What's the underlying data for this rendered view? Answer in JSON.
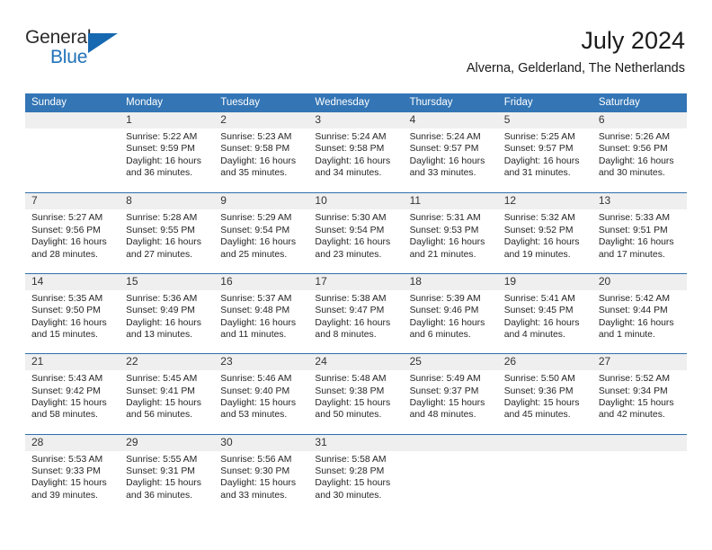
{
  "brand": {
    "word_one": "General",
    "word_two": "Blue",
    "logo_icon": "triangle-logo-icon",
    "colors": {
      "general": "#2b2b2b",
      "blue": "#2272b8",
      "triangle": "#1668b0"
    }
  },
  "header": {
    "title": "July 2024",
    "subtitle": "Alverna, Gelderland, The Netherlands"
  },
  "theme": {
    "header_bar": "#3375b5",
    "row_divider": "#2f6fad",
    "number_band": "#efefef",
    "text": "#262626"
  },
  "calendar": {
    "day_headers": [
      "Sunday",
      "Monday",
      "Tuesday",
      "Wednesday",
      "Thursday",
      "Friday",
      "Saturday"
    ],
    "weeks": [
      [
        {
          "day": "",
          "empty": true,
          "sunrise": "",
          "sunset": "",
          "daylight_1": "",
          "daylight_2": ""
        },
        {
          "day": "1",
          "sunrise": "Sunrise: 5:22 AM",
          "sunset": "Sunset: 9:59 PM",
          "daylight_1": "Daylight: 16 hours",
          "daylight_2": "and 36 minutes."
        },
        {
          "day": "2",
          "sunrise": "Sunrise: 5:23 AM",
          "sunset": "Sunset: 9:58 PM",
          "daylight_1": "Daylight: 16 hours",
          "daylight_2": "and 35 minutes."
        },
        {
          "day": "3",
          "sunrise": "Sunrise: 5:24 AM",
          "sunset": "Sunset: 9:58 PM",
          "daylight_1": "Daylight: 16 hours",
          "daylight_2": "and 34 minutes."
        },
        {
          "day": "4",
          "sunrise": "Sunrise: 5:24 AM",
          "sunset": "Sunset: 9:57 PM",
          "daylight_1": "Daylight: 16 hours",
          "daylight_2": "and 33 minutes."
        },
        {
          "day": "5",
          "sunrise": "Sunrise: 5:25 AM",
          "sunset": "Sunset: 9:57 PM",
          "daylight_1": "Daylight: 16 hours",
          "daylight_2": "and 31 minutes."
        },
        {
          "day": "6",
          "sunrise": "Sunrise: 5:26 AM",
          "sunset": "Sunset: 9:56 PM",
          "daylight_1": "Daylight: 16 hours",
          "daylight_2": "and 30 minutes."
        }
      ],
      [
        {
          "day": "7",
          "sunrise": "Sunrise: 5:27 AM",
          "sunset": "Sunset: 9:56 PM",
          "daylight_1": "Daylight: 16 hours",
          "daylight_2": "and 28 minutes."
        },
        {
          "day": "8",
          "sunrise": "Sunrise: 5:28 AM",
          "sunset": "Sunset: 9:55 PM",
          "daylight_1": "Daylight: 16 hours",
          "daylight_2": "and 27 minutes."
        },
        {
          "day": "9",
          "sunrise": "Sunrise: 5:29 AM",
          "sunset": "Sunset: 9:54 PM",
          "daylight_1": "Daylight: 16 hours",
          "daylight_2": "and 25 minutes."
        },
        {
          "day": "10",
          "sunrise": "Sunrise: 5:30 AM",
          "sunset": "Sunset: 9:54 PM",
          "daylight_1": "Daylight: 16 hours",
          "daylight_2": "and 23 minutes."
        },
        {
          "day": "11",
          "sunrise": "Sunrise: 5:31 AM",
          "sunset": "Sunset: 9:53 PM",
          "daylight_1": "Daylight: 16 hours",
          "daylight_2": "and 21 minutes."
        },
        {
          "day": "12",
          "sunrise": "Sunrise: 5:32 AM",
          "sunset": "Sunset: 9:52 PM",
          "daylight_1": "Daylight: 16 hours",
          "daylight_2": "and 19 minutes."
        },
        {
          "day": "13",
          "sunrise": "Sunrise: 5:33 AM",
          "sunset": "Sunset: 9:51 PM",
          "daylight_1": "Daylight: 16 hours",
          "daylight_2": "and 17 minutes."
        }
      ],
      [
        {
          "day": "14",
          "sunrise": "Sunrise: 5:35 AM",
          "sunset": "Sunset: 9:50 PM",
          "daylight_1": "Daylight: 16 hours",
          "daylight_2": "and 15 minutes."
        },
        {
          "day": "15",
          "sunrise": "Sunrise: 5:36 AM",
          "sunset": "Sunset: 9:49 PM",
          "daylight_1": "Daylight: 16 hours",
          "daylight_2": "and 13 minutes."
        },
        {
          "day": "16",
          "sunrise": "Sunrise: 5:37 AM",
          "sunset": "Sunset: 9:48 PM",
          "daylight_1": "Daylight: 16 hours",
          "daylight_2": "and 11 minutes."
        },
        {
          "day": "17",
          "sunrise": "Sunrise: 5:38 AM",
          "sunset": "Sunset: 9:47 PM",
          "daylight_1": "Daylight: 16 hours",
          "daylight_2": "and 8 minutes."
        },
        {
          "day": "18",
          "sunrise": "Sunrise: 5:39 AM",
          "sunset": "Sunset: 9:46 PM",
          "daylight_1": "Daylight: 16 hours",
          "daylight_2": "and 6 minutes."
        },
        {
          "day": "19",
          "sunrise": "Sunrise: 5:41 AM",
          "sunset": "Sunset: 9:45 PM",
          "daylight_1": "Daylight: 16 hours",
          "daylight_2": "and 4 minutes."
        },
        {
          "day": "20",
          "sunrise": "Sunrise: 5:42 AM",
          "sunset": "Sunset: 9:44 PM",
          "daylight_1": "Daylight: 16 hours",
          "daylight_2": "and 1 minute."
        }
      ],
      [
        {
          "day": "21",
          "sunrise": "Sunrise: 5:43 AM",
          "sunset": "Sunset: 9:42 PM",
          "daylight_1": "Daylight: 15 hours",
          "daylight_2": "and 58 minutes."
        },
        {
          "day": "22",
          "sunrise": "Sunrise: 5:45 AM",
          "sunset": "Sunset: 9:41 PM",
          "daylight_1": "Daylight: 15 hours",
          "daylight_2": "and 56 minutes."
        },
        {
          "day": "23",
          "sunrise": "Sunrise: 5:46 AM",
          "sunset": "Sunset: 9:40 PM",
          "daylight_1": "Daylight: 15 hours",
          "daylight_2": "and 53 minutes."
        },
        {
          "day": "24",
          "sunrise": "Sunrise: 5:48 AM",
          "sunset": "Sunset: 9:38 PM",
          "daylight_1": "Daylight: 15 hours",
          "daylight_2": "and 50 minutes."
        },
        {
          "day": "25",
          "sunrise": "Sunrise: 5:49 AM",
          "sunset": "Sunset: 9:37 PM",
          "daylight_1": "Daylight: 15 hours",
          "daylight_2": "and 48 minutes."
        },
        {
          "day": "26",
          "sunrise": "Sunrise: 5:50 AM",
          "sunset": "Sunset: 9:36 PM",
          "daylight_1": "Daylight: 15 hours",
          "daylight_2": "and 45 minutes."
        },
        {
          "day": "27",
          "sunrise": "Sunrise: 5:52 AM",
          "sunset": "Sunset: 9:34 PM",
          "daylight_1": "Daylight: 15 hours",
          "daylight_2": "and 42 minutes."
        }
      ],
      [
        {
          "day": "28",
          "sunrise": "Sunrise: 5:53 AM",
          "sunset": "Sunset: 9:33 PM",
          "daylight_1": "Daylight: 15 hours",
          "daylight_2": "and 39 minutes."
        },
        {
          "day": "29",
          "sunrise": "Sunrise: 5:55 AM",
          "sunset": "Sunset: 9:31 PM",
          "daylight_1": "Daylight: 15 hours",
          "daylight_2": "and 36 minutes."
        },
        {
          "day": "30",
          "sunrise": "Sunrise: 5:56 AM",
          "sunset": "Sunset: 9:30 PM",
          "daylight_1": "Daylight: 15 hours",
          "daylight_2": "and 33 minutes."
        },
        {
          "day": "31",
          "sunrise": "Sunrise: 5:58 AM",
          "sunset": "Sunset: 9:28 PM",
          "daylight_1": "Daylight: 15 hours",
          "daylight_2": "and 30 minutes."
        },
        {
          "day": "",
          "empty": true,
          "sunrise": "",
          "sunset": "",
          "daylight_1": "",
          "daylight_2": ""
        },
        {
          "day": "",
          "empty": true,
          "sunrise": "",
          "sunset": "",
          "daylight_1": "",
          "daylight_2": ""
        },
        {
          "day": "",
          "empty": true,
          "sunrise": "",
          "sunset": "",
          "daylight_1": "",
          "daylight_2": ""
        }
      ]
    ]
  }
}
